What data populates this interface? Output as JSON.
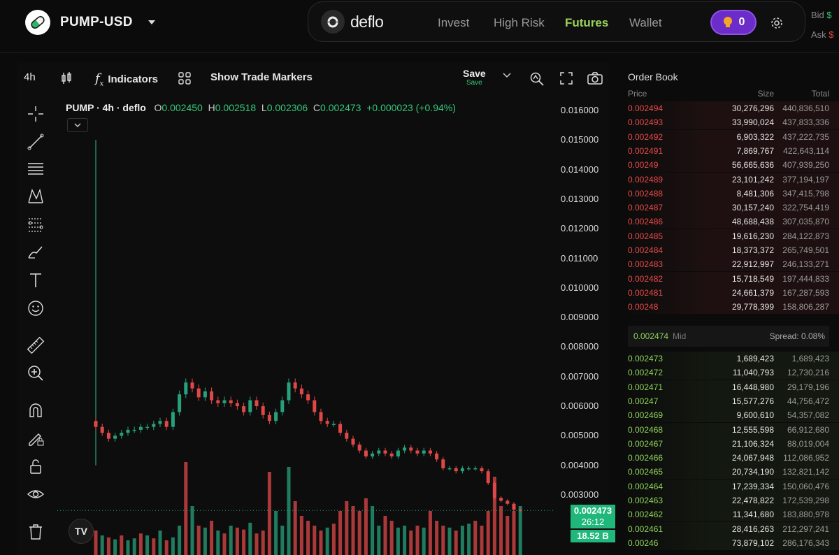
{
  "header": {
    "pair": "PUMP-USD",
    "brand": "deflo",
    "nav": [
      {
        "label": "Invest",
        "active": false
      },
      {
        "label": "High Risk",
        "active": false
      },
      {
        "label": "Futures",
        "active": true
      },
      {
        "label": "Wallet",
        "active": false
      }
    ],
    "points": "0",
    "bid_label": "Bid",
    "ask_label": "Ask",
    "bid_value": "$",
    "ask_value": "$"
  },
  "chart_toolbar": {
    "interval": "4h",
    "indicators": "Indicators",
    "trade_markers": "Show Trade Markers",
    "save": "Save",
    "save_sub": "Save"
  },
  "legend": {
    "symbol": "PUMP · 4h · deflo",
    "o_label": "O",
    "o": "0.002450",
    "h_label": "H",
    "h": "0.002518",
    "l_label": "L",
    "l": "0.002306",
    "c_label": "C",
    "c": "0.002473",
    "change": "+0.000023 (+0.94%)"
  },
  "chart_data": {
    "type": "candlestick",
    "symbol": "PUMP",
    "interval": "4h",
    "y_ticks": [
      "0.016000",
      "0.015000",
      "0.014000",
      "0.013000",
      "0.012000",
      "0.011000",
      "0.010000",
      "0.009000",
      "0.008000",
      "0.007000",
      "0.006000",
      "0.005000",
      "0.004000",
      "0.003000"
    ],
    "ylim": [
      0.0025,
      0.0163
    ],
    "last_price": "0.002473",
    "countdown": "26:12",
    "volume_label": "18.52 B",
    "close_path": [
      0.0053,
      0.0051,
      0.0049,
      0.005,
      0.0051,
      0.0052,
      0.0052,
      0.0053,
      0.0053,
      0.0054,
      0.0055,
      0.0053,
      0.0058,
      0.0064,
      0.0068,
      0.0066,
      0.0063,
      0.0065,
      0.0062,
      0.0061,
      0.0062,
      0.0061,
      0.006,
      0.0058,
      0.0062,
      0.006,
      0.0057,
      0.0055,
      0.0058,
      0.0062,
      0.0068,
      0.0066,
      0.0064,
      0.0062,
      0.0058,
      0.0055,
      0.0054,
      0.0054,
      0.0051,
      0.0049,
      0.0047,
      0.0045,
      0.0043,
      0.0044,
      0.0045,
      0.0044,
      0.0043,
      0.0045,
      0.0046,
      0.0045,
      0.0044,
      0.0045,
      0.0044,
      0.0042,
      0.0039,
      0.0039,
      0.0038,
      0.0039,
      0.0039,
      0.0039,
      0.0038,
      0.0034,
      0.0029,
      0.0028,
      0.0027,
      0.0025,
      0.00247
    ],
    "volume_rel": [
      0.25,
      0.2,
      0.18,
      0.16,
      0.2,
      0.15,
      0.17,
      0.22,
      0.2,
      0.17,
      0.25,
      0.15,
      0.18,
      0.3,
      0.95,
      0.5,
      0.3,
      0.28,
      0.35,
      0.25,
      0.22,
      0.3,
      0.28,
      0.26,
      0.33,
      0.22,
      0.25,
      0.85,
      0.45,
      0.3,
      0.9,
      0.55,
      0.4,
      0.35,
      0.3,
      0.25,
      0.28,
      0.32,
      0.45,
      0.55,
      0.5,
      0.45,
      0.58,
      0.5,
      0.3,
      0.4,
      0.35,
      0.28,
      0.3,
      0.25,
      0.3,
      0.28,
      0.45,
      0.35,
      0.3,
      0.28,
      0.25,
      0.3,
      0.32,
      0.35,
      0.3,
      0.45,
      0.8,
      0.5,
      0.4,
      0.45,
      0.5
    ],
    "volume_up": [
      0,
      1,
      0,
      1,
      0,
      1,
      1,
      0,
      1,
      0,
      1,
      0,
      1,
      1,
      0,
      1,
      0,
      1,
      0,
      1,
      0,
      1,
      0,
      0,
      1,
      0,
      0,
      0,
      1,
      1,
      1,
      0,
      0,
      0,
      0,
      0,
      1,
      0,
      0,
      0,
      0,
      0,
      0,
      1,
      1,
      0,
      0,
      1,
      1,
      0,
      0,
      1,
      0,
      0,
      0,
      1,
      0,
      1,
      1,
      0,
      0,
      0,
      0,
      0,
      0,
      0,
      1
    ]
  },
  "orderbook": {
    "title": "Order Book",
    "col_price": "Price",
    "col_size": "Size",
    "col_total": "Total",
    "asks": [
      [
        "0.002494",
        "30,276,296",
        "440,836,510"
      ],
      [
        "0.002493",
        "33,990,024",
        "437,833,336"
      ],
      [
        "0.002492",
        "6,903,322",
        "437,222,735"
      ],
      [
        "0.002491",
        "7,869,767",
        "422,643,114"
      ],
      [
        "0.00249",
        "56,665,636",
        "407,939,250"
      ],
      [
        "0.002489",
        "23,101,242",
        "377,194,197"
      ],
      [
        "0.002488",
        "8,481,306",
        "347,415,798"
      ],
      [
        "0.002487",
        "30,157,240",
        "322,754,419"
      ],
      [
        "0.002486",
        "48,688,438",
        "307,035,870"
      ],
      [
        "0.002485",
        "19,616,230",
        "284,122,873"
      ],
      [
        "0.002484",
        "18,373,372",
        "265,749,501"
      ],
      [
        "0.002483",
        "22,912,997",
        "246,133,271"
      ],
      [
        "0.002482",
        "15,718,549",
        "197,444,833"
      ],
      [
        "0.002481",
        "24,661,379",
        "167,287,593"
      ],
      [
        "0.00248",
        "29,778,399",
        "158,806,287"
      ]
    ],
    "mid_price": "0.002474",
    "mid_label": "Mid",
    "spread": "Spread: 0.08%",
    "bids": [
      [
        "0.002473",
        "1,689,423",
        "1,689,423"
      ],
      [
        "0.002472",
        "11,040,793",
        "12,730,216"
      ],
      [
        "0.002471",
        "16,448,980",
        "29,179,196"
      ],
      [
        "0.00247",
        "15,577,276",
        "44,756,472"
      ],
      [
        "0.002469",
        "9,600,610",
        "54,357,082"
      ],
      [
        "0.002468",
        "12,555,598",
        "66,912,680"
      ],
      [
        "0.002467",
        "21,106,324",
        "88,019,004"
      ],
      [
        "0.002466",
        "24,067,948",
        "112,086,952"
      ],
      [
        "0.002465",
        "20,734,190",
        "132,821,142"
      ],
      [
        "0.002464",
        "17,239,334",
        "150,060,476"
      ],
      [
        "0.002463",
        "22,478,822",
        "172,539,298"
      ],
      [
        "0.002462",
        "11,341,680",
        "183,880,978"
      ],
      [
        "0.002461",
        "28,416,263",
        "212,297,241"
      ],
      [
        "0.00246",
        "73,879,102",
        "286,176,343"
      ]
    ]
  },
  "colors": {
    "up": "#26a17b",
    "down": "#e04848",
    "accent": "#9cd35a",
    "points_bg": "#6b2cc9"
  }
}
